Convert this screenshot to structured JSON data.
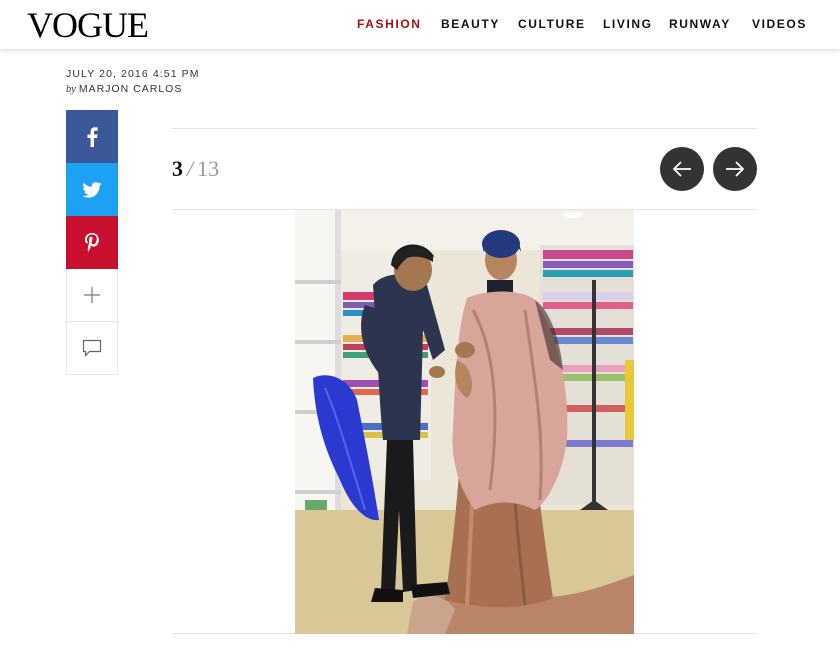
{
  "header": {
    "logo": "VOGUE",
    "nav": [
      {
        "label": "FASHION",
        "active": true
      },
      {
        "label": "BEAUTY",
        "active": false
      },
      {
        "label": "CULTURE",
        "active": false
      },
      {
        "label": "LIVING",
        "active": false
      },
      {
        "label": "RUNWAY",
        "active": false
      },
      {
        "label": "VIDEOS",
        "active": false
      }
    ],
    "active_color": "#a50f17"
  },
  "article": {
    "date": "JULY 20, 2016 4:51 PM",
    "by": "by",
    "author": "MARJON CARLOS"
  },
  "share": {
    "items": [
      "facebook-icon",
      "twitter-icon",
      "pinterest-icon",
      "plus-icon",
      "comment-icon"
    ],
    "colors": {
      "facebook": "#3b5998",
      "twitter": "#1da1f2",
      "pinterest": "#c8102e"
    }
  },
  "gallery": {
    "current": "3",
    "separator": "/",
    "total": "13",
    "prev_icon": "arrow-left-icon",
    "next_icon": "arrow-right-icon"
  }
}
